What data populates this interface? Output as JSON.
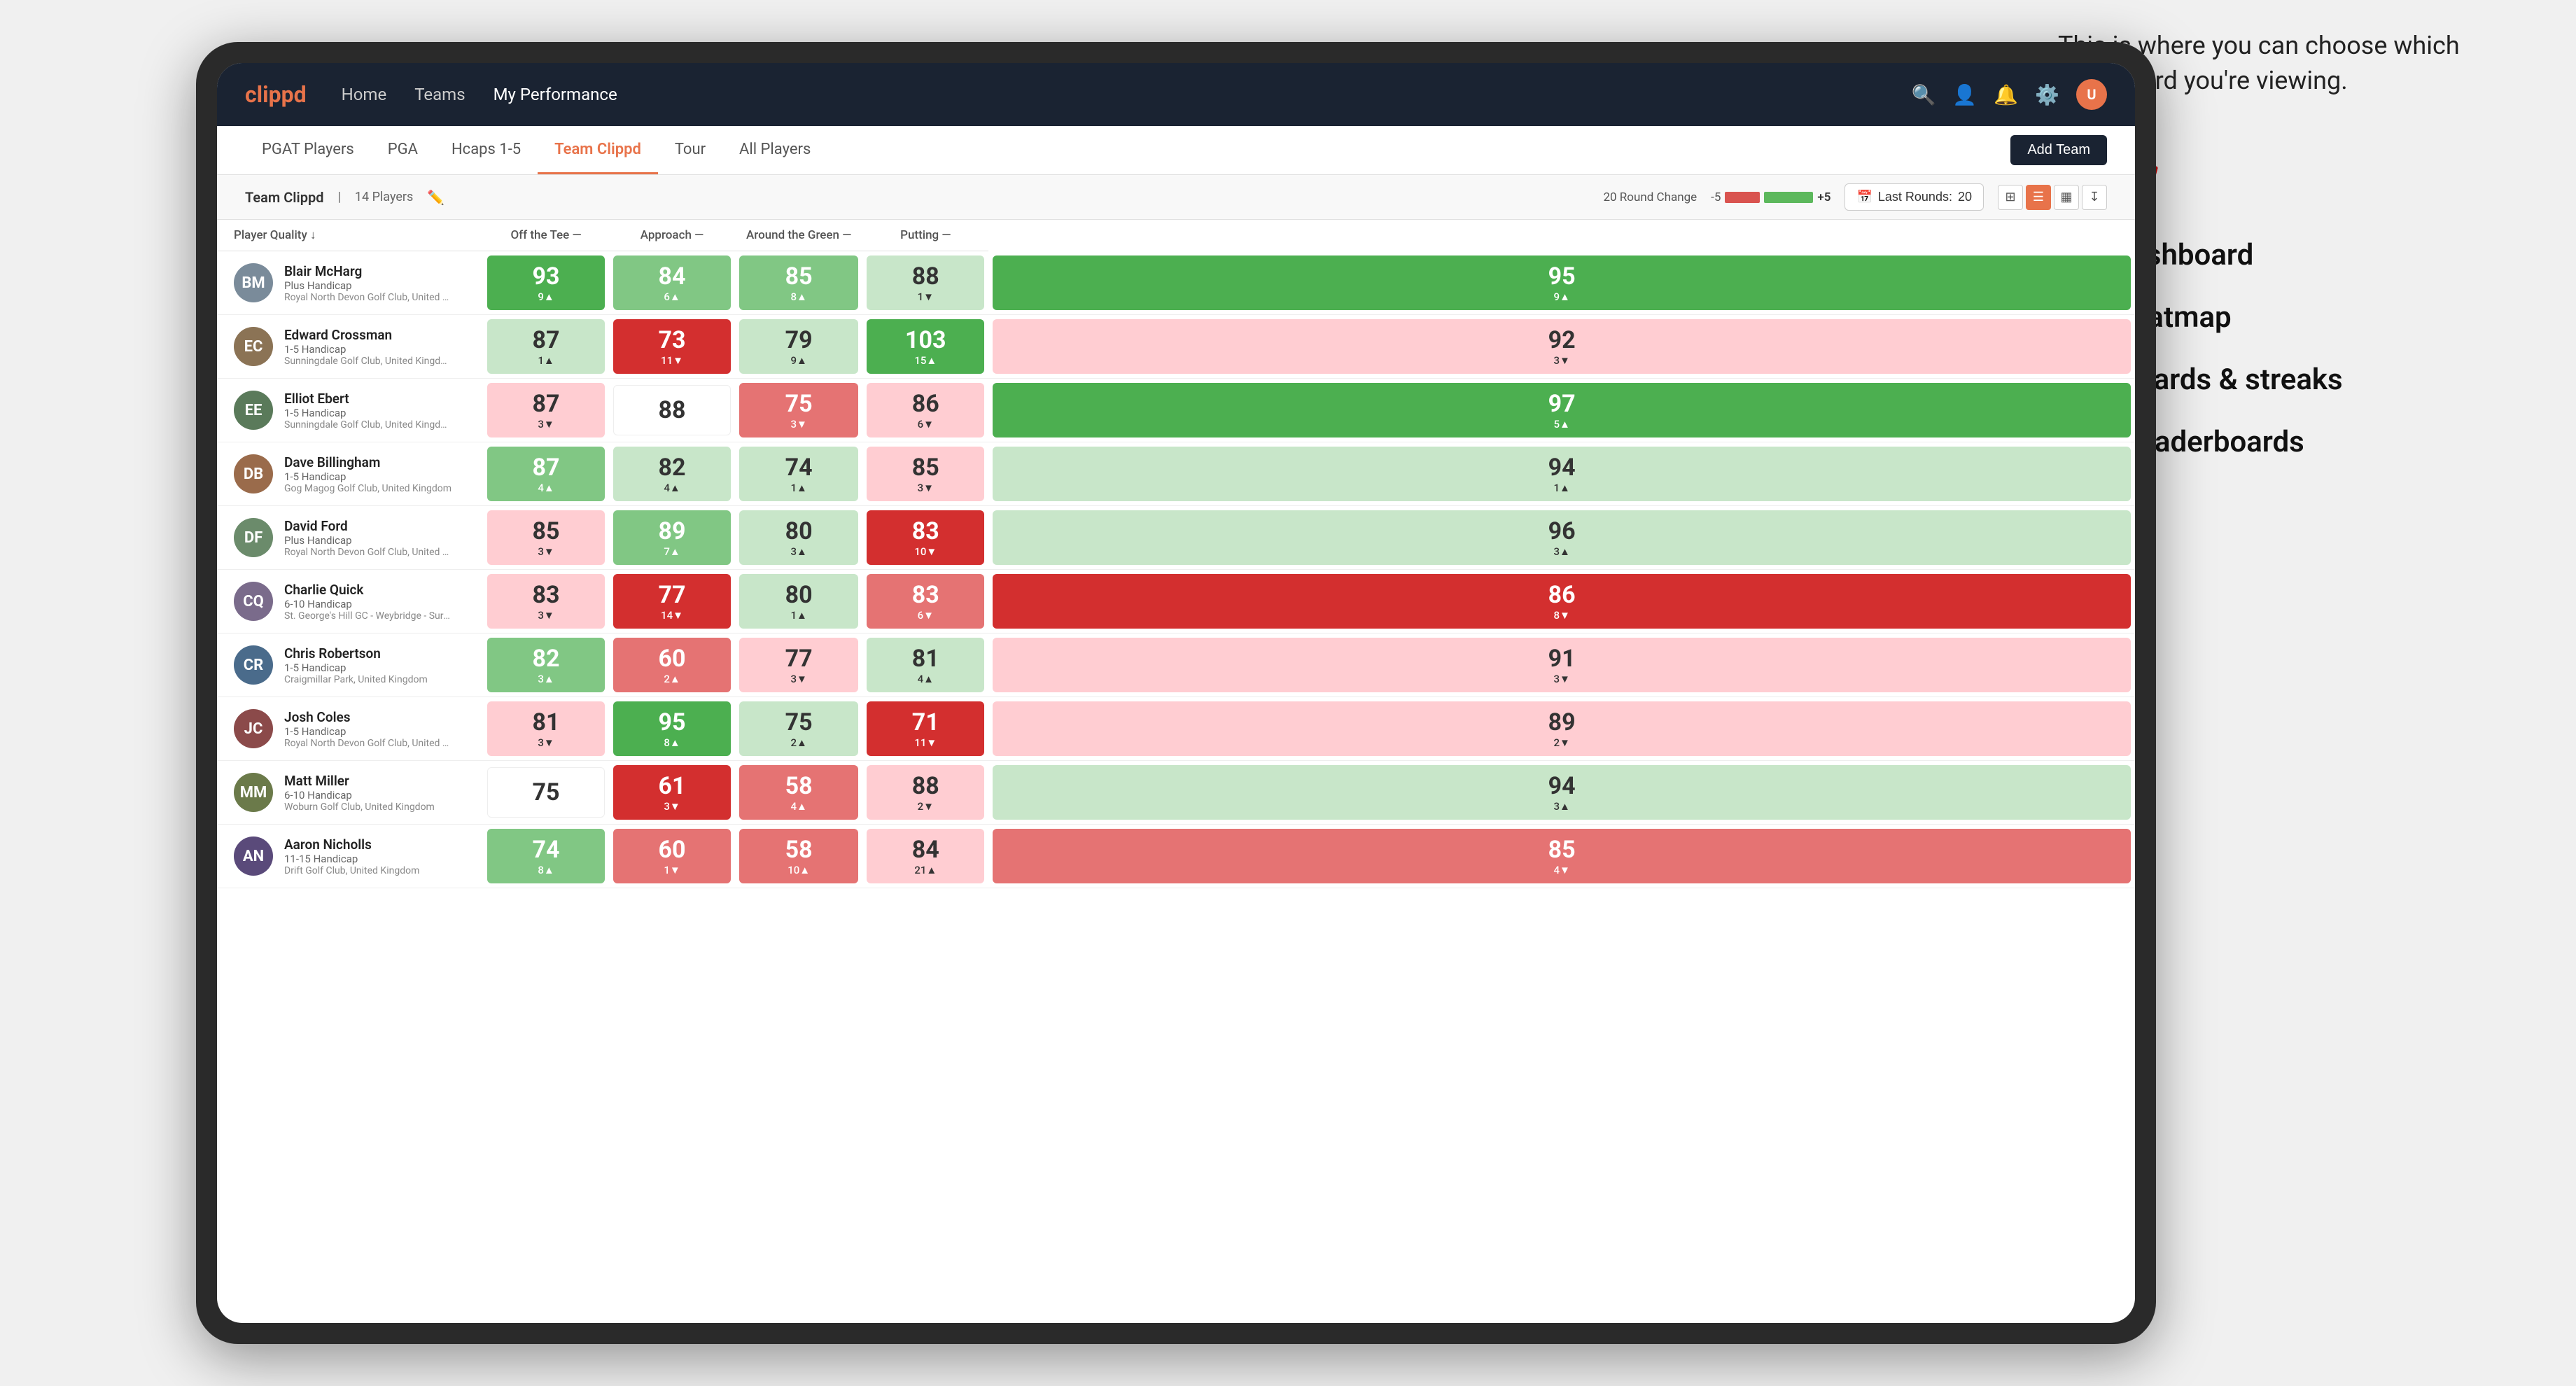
{
  "annotation": {
    "intro": "This is where you can choose which dashboard you're viewing.",
    "items": [
      "Team Dashboard",
      "Team Heatmap",
      "Leaderboards & streaks",
      "Course leaderboards"
    ]
  },
  "nav": {
    "logo": "clippd",
    "links": [
      "Home",
      "Teams",
      "My Performance"
    ],
    "active_link": "My Performance"
  },
  "sub_nav": {
    "links": [
      "PGAT Players",
      "PGA",
      "Hcaps 1-5",
      "Team Clippd",
      "Tour",
      "All Players"
    ],
    "active_link": "Team Clippd",
    "add_button": "Add Team"
  },
  "team_header": {
    "title": "Team Clippd",
    "separator": "|",
    "count": "14 Players",
    "round_change_label": "20 Round Change",
    "round_change_min": "-5",
    "round_change_max": "+5",
    "last_rounds_label": "Last Rounds:",
    "last_rounds_value": "20"
  },
  "table": {
    "columns": {
      "player": "Player Quality",
      "off_tee": "Off the Tee",
      "approach": "Approach",
      "around_green": "Around the Green",
      "putting": "Putting"
    },
    "rows": [
      {
        "name": "Blair McHarg",
        "hcp": "Plus Handicap",
        "club": "Royal North Devon Golf Club, United Kingdom",
        "avatar_color": "#7a8b9a",
        "initials": "BM",
        "player_quality": {
          "value": "93",
          "change": "9▲",
          "direction": "up",
          "bg": "bg-green-dark"
        },
        "off_tee": {
          "value": "84",
          "change": "6▲",
          "direction": "up",
          "bg": "bg-green-mid"
        },
        "approach": {
          "value": "85",
          "change": "8▲",
          "direction": "up",
          "bg": "bg-green-mid"
        },
        "around_green": {
          "value": "88",
          "change": "1▼",
          "direction": "down",
          "bg": "bg-green-light"
        },
        "putting": {
          "value": "95",
          "change": "9▲",
          "direction": "up",
          "bg": "bg-green-dark"
        }
      },
      {
        "name": "Edward Crossman",
        "hcp": "1-5 Handicap",
        "club": "Sunningdale Golf Club, United Kingdom",
        "avatar_color": "#8b7355",
        "initials": "EC",
        "player_quality": {
          "value": "87",
          "change": "1▲",
          "direction": "up",
          "bg": "bg-green-light"
        },
        "off_tee": {
          "value": "73",
          "change": "11▼",
          "direction": "down",
          "bg": "bg-red-dark"
        },
        "approach": {
          "value": "79",
          "change": "9▲",
          "direction": "up",
          "bg": "bg-green-light"
        },
        "around_green": {
          "value": "103",
          "change": "15▲",
          "direction": "up",
          "bg": "bg-green-dark"
        },
        "putting": {
          "value": "92",
          "change": "3▼",
          "direction": "down",
          "bg": "bg-red-light"
        }
      },
      {
        "name": "Elliot Ebert",
        "hcp": "1-5 Handicap",
        "club": "Sunningdale Golf Club, United Kingdom",
        "avatar_color": "#5a7a5a",
        "initials": "EE",
        "player_quality": {
          "value": "87",
          "change": "3▼",
          "direction": "down",
          "bg": "bg-red-light"
        },
        "off_tee": {
          "value": "88",
          "change": "",
          "direction": "neutral",
          "bg": "bg-white"
        },
        "approach": {
          "value": "75",
          "change": "3▼",
          "direction": "down",
          "bg": "bg-red-mid"
        },
        "around_green": {
          "value": "86",
          "change": "6▼",
          "direction": "down",
          "bg": "bg-red-light"
        },
        "putting": {
          "value": "97",
          "change": "5▲",
          "direction": "up",
          "bg": "bg-green-dark"
        }
      },
      {
        "name": "Dave Billingham",
        "hcp": "1-5 Handicap",
        "club": "Gog Magog Golf Club, United Kingdom",
        "avatar_color": "#9a6b4b",
        "initials": "DB",
        "player_quality": {
          "value": "87",
          "change": "4▲",
          "direction": "up",
          "bg": "bg-green-mid"
        },
        "off_tee": {
          "value": "82",
          "change": "4▲",
          "direction": "up",
          "bg": "bg-green-light"
        },
        "approach": {
          "value": "74",
          "change": "1▲",
          "direction": "up",
          "bg": "bg-green-light"
        },
        "around_green": {
          "value": "85",
          "change": "3▼",
          "direction": "down",
          "bg": "bg-red-light"
        },
        "putting": {
          "value": "94",
          "change": "1▲",
          "direction": "up",
          "bg": "bg-green-light"
        }
      },
      {
        "name": "David Ford",
        "hcp": "Plus Handicap",
        "club": "Royal North Devon Golf Club, United Kingdom",
        "avatar_color": "#6b8b6b",
        "initials": "DF",
        "player_quality": {
          "value": "85",
          "change": "3▼",
          "direction": "down",
          "bg": "bg-red-light"
        },
        "off_tee": {
          "value": "89",
          "change": "7▲",
          "direction": "up",
          "bg": "bg-green-mid"
        },
        "approach": {
          "value": "80",
          "change": "3▲",
          "direction": "up",
          "bg": "bg-green-light"
        },
        "around_green": {
          "value": "83",
          "change": "10▼",
          "direction": "down",
          "bg": "bg-red-dark"
        },
        "putting": {
          "value": "96",
          "change": "3▲",
          "direction": "up",
          "bg": "bg-green-light"
        }
      },
      {
        "name": "Charlie Quick",
        "hcp": "6-10 Handicap",
        "club": "St. George's Hill GC - Weybridge - Surrey, Uni...",
        "avatar_color": "#7a6b8b",
        "initials": "CQ",
        "player_quality": {
          "value": "83",
          "change": "3▼",
          "direction": "down",
          "bg": "bg-red-light"
        },
        "off_tee": {
          "value": "77",
          "change": "14▼",
          "direction": "down",
          "bg": "bg-red-dark"
        },
        "approach": {
          "value": "80",
          "change": "1▲",
          "direction": "up",
          "bg": "bg-green-light"
        },
        "around_green": {
          "value": "83",
          "change": "6▼",
          "direction": "down",
          "bg": "bg-red-mid"
        },
        "putting": {
          "value": "86",
          "change": "8▼",
          "direction": "down",
          "bg": "bg-red-dark"
        }
      },
      {
        "name": "Chris Robertson",
        "hcp": "1-5 Handicap",
        "club": "Craigmillar Park, United Kingdom",
        "avatar_color": "#4a6b8b",
        "initials": "CR",
        "player_quality": {
          "value": "82",
          "change": "3▲",
          "direction": "up",
          "bg": "bg-green-mid"
        },
        "off_tee": {
          "value": "60",
          "change": "2▲",
          "direction": "up",
          "bg": "bg-red-mid"
        },
        "approach": {
          "value": "77",
          "change": "3▼",
          "direction": "down",
          "bg": "bg-red-light"
        },
        "around_green": {
          "value": "81",
          "change": "4▲",
          "direction": "up",
          "bg": "bg-green-light"
        },
        "putting": {
          "value": "91",
          "change": "3▼",
          "direction": "down",
          "bg": "bg-red-light"
        }
      },
      {
        "name": "Josh Coles",
        "hcp": "1-5 Handicap",
        "club": "Royal North Devon Golf Club, United Kingdom",
        "avatar_color": "#8b4a4a",
        "initials": "JC",
        "player_quality": {
          "value": "81",
          "change": "3▼",
          "direction": "down",
          "bg": "bg-red-light"
        },
        "off_tee": {
          "value": "95",
          "change": "8▲",
          "direction": "up",
          "bg": "bg-green-dark"
        },
        "approach": {
          "value": "75",
          "change": "2▲",
          "direction": "up",
          "bg": "bg-green-light"
        },
        "around_green": {
          "value": "71",
          "change": "11▼",
          "direction": "down",
          "bg": "bg-red-dark"
        },
        "putting": {
          "value": "89",
          "change": "2▼",
          "direction": "down",
          "bg": "bg-red-light"
        }
      },
      {
        "name": "Matt Miller",
        "hcp": "6-10 Handicap",
        "club": "Woburn Golf Club, United Kingdom",
        "avatar_color": "#6b7a4a",
        "initials": "MM",
        "player_quality": {
          "value": "75",
          "change": "",
          "direction": "neutral",
          "bg": "bg-white"
        },
        "off_tee": {
          "value": "61",
          "change": "3▼",
          "direction": "down",
          "bg": "bg-red-dark"
        },
        "approach": {
          "value": "58",
          "change": "4▲",
          "direction": "up",
          "bg": "bg-red-mid"
        },
        "around_green": {
          "value": "88",
          "change": "2▼",
          "direction": "down",
          "bg": "bg-red-light"
        },
        "putting": {
          "value": "94",
          "change": "3▲",
          "direction": "up",
          "bg": "bg-green-light"
        }
      },
      {
        "name": "Aaron Nicholls",
        "hcp": "11-15 Handicap",
        "club": "Drift Golf Club, United Kingdom",
        "avatar_color": "#5a4a7a",
        "initials": "AN",
        "player_quality": {
          "value": "74",
          "change": "8▲",
          "direction": "up",
          "bg": "bg-green-mid"
        },
        "off_tee": {
          "value": "60",
          "change": "1▼",
          "direction": "down",
          "bg": "bg-red-mid"
        },
        "approach": {
          "value": "58",
          "change": "10▲",
          "direction": "up",
          "bg": "bg-red-mid"
        },
        "around_green": {
          "value": "84",
          "change": "21▲",
          "direction": "up",
          "bg": "bg-red-light"
        },
        "putting": {
          "value": "85",
          "change": "4▼",
          "direction": "down",
          "bg": "bg-red-mid"
        }
      }
    ]
  }
}
